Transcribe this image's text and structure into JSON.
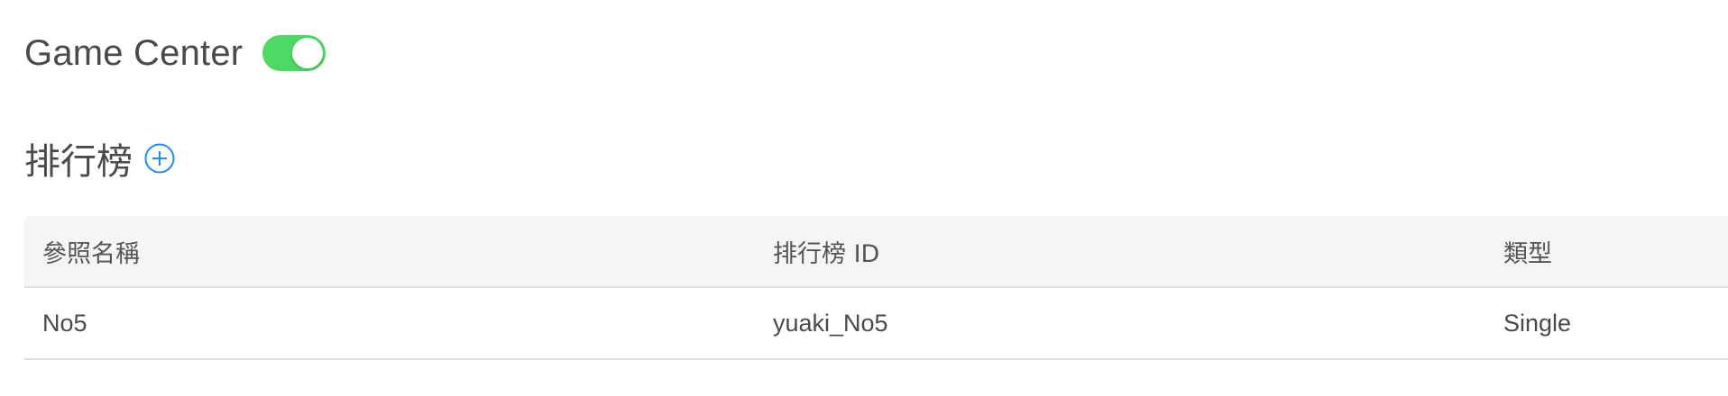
{
  "game_center": {
    "title": "Game Center",
    "toggle_on": true,
    "toggle_color": "#4cd964"
  },
  "leaderboards": {
    "title": "排行榜",
    "add_icon": "plus-circle-icon",
    "accent_color": "#1a8cff",
    "columns": [
      "參照名稱",
      "排行榜 ID",
      "類型"
    ],
    "rows": [
      [
        "No5",
        "yuaki_No5",
        "Single"
      ]
    ]
  }
}
